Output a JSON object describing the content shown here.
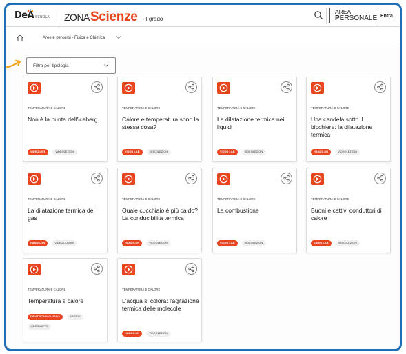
{
  "header": {
    "logo_text": "DeA",
    "logo_sub": "SCUOLA",
    "brand_prefix": "ZONA",
    "brand_main": "Scienze",
    "grade": "- I grado",
    "area_line1_a": "AREA",
    "area_line1_b": "",
    "area_line2_a": "P",
    "area_line2_b": "ERSONALE",
    "login": "Entra"
  },
  "breadcrumb": {
    "label": "Aree e percorsi - Fisica e Chimica"
  },
  "filter": {
    "label": "Filtra per tipologia"
  },
  "colors": {
    "accent": "#e8451f",
    "frame": "#1f6fb8",
    "pointer": "#f2a314"
  },
  "cards": [
    {
      "category": "TEMPERATURA E CALORE",
      "title": "Non è la punta dell'iceberg",
      "tags": [
        {
          "label": "VIDEO LIVE",
          "primary": true
        },
        {
          "label": "VIDEOLEZIONI",
          "primary": false
        }
      ]
    },
    {
      "category": "TEMPERATURA E CALORE",
      "title": "Calore e temperatura sono la stessa cosa?",
      "tags": [
        {
          "label": "VIDEO LAB",
          "primary": true
        },
        {
          "label": "VIDEOLEZIONI",
          "primary": false
        }
      ]
    },
    {
      "category": "TEMPERATURA E CALORE",
      "title": "La dilatazione termica nei liquidi",
      "tags": [
        {
          "label": "VIDEO LAB",
          "primary": true
        },
        {
          "label": "VIDEOLEZIONI",
          "primary": false
        }
      ]
    },
    {
      "category": "TEMPERATURA E CALORE",
      "title": "Una candela sotto il bicchiere: la dilatazione termica",
      "tags": [
        {
          "label": "HANDS-ON",
          "primary": true
        },
        {
          "label": "VIDEOLEZIONI",
          "primary": false
        }
      ]
    },
    {
      "category": "TEMPERATURA E CALORE",
      "title": "La dilatazione termica dei gas",
      "tags": [
        {
          "label": "HANDS-ON",
          "primary": true
        },
        {
          "label": "VIDEOLEZIONI",
          "primary": false
        }
      ]
    },
    {
      "category": "TEMPERATURA E CALORE",
      "title": "Quale cucchiaio è più caldo? La conducibilità termica",
      "tags": [
        {
          "label": "HANDS-ON",
          "primary": true
        },
        {
          "label": "VIDEOLEZIONI",
          "primary": false
        }
      ]
    },
    {
      "category": "TEMPERATURA E CALORE",
      "title": "La combustione",
      "tags": [
        {
          "label": "VIDEO LAB",
          "primary": true
        },
        {
          "label": "VIDEOLEZIONI",
          "primary": false
        }
      ]
    },
    {
      "category": "TEMPERATURA E CALORE",
      "title": "Buoni e cattivi conduttori di calore",
      "tags": [
        {
          "label": "VIDEO LAB",
          "primary": true
        },
        {
          "label": "VIDEOLEZIONI",
          "primary": false
        }
      ]
    },
    {
      "category": "TEMPERATURA E CALORE",
      "title": "Temperatura e calore",
      "tags": [
        {
          "label": "DIDATTICA INCLUSIVA",
          "primary": true
        },
        {
          "label": "SINTESI",
          "primary": false
        },
        {
          "label": "VIDEOMAPPE",
          "primary": false
        }
      ]
    },
    {
      "category": "TEMPERATURA E CALORE",
      "title": "L'acqua si colora: l'agitazione termica delle molecole",
      "tags": [
        {
          "label": "HANDS-ON",
          "primary": true
        },
        {
          "label": "VIDEOLEZIONI",
          "primary": false
        }
      ]
    }
  ]
}
